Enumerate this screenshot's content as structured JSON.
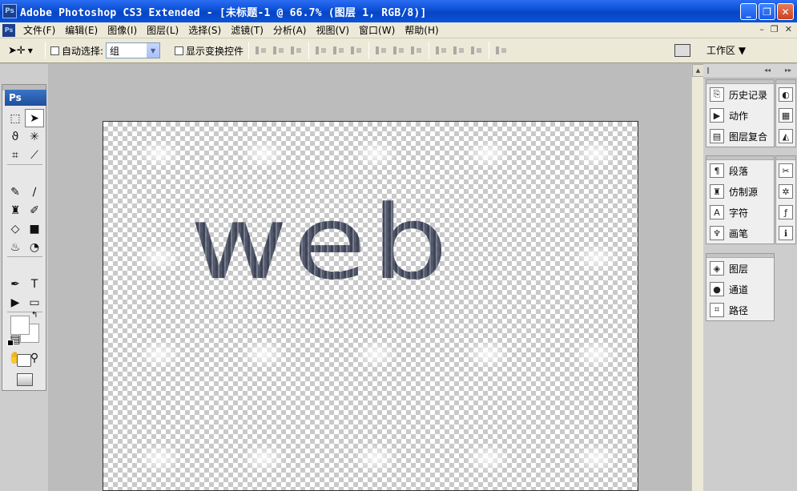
{
  "window": {
    "title": "Adobe Photoshop CS3 Extended - [未标题-1 @ 66.7% (图层 1, RGB/8)]",
    "app_icon": "Ps",
    "buttons": [
      "_",
      "❐",
      "✕"
    ]
  },
  "menu": {
    "items": [
      "文件(F)",
      "编辑(E)",
      "图像(I)",
      "图层(L)",
      "选择(S)",
      "滤镜(T)",
      "分析(A)",
      "视图(V)",
      "窗口(W)",
      "帮助(H)"
    ],
    "doc_buttons": [
      "–",
      "❐",
      "✕"
    ]
  },
  "options": {
    "auto_select_label": "自动选择:",
    "auto_select_value": "组",
    "show_transform_label": "显示变换控件",
    "workspace_label": "工作区 ▼"
  },
  "toolbox": {
    "logo": "Ps"
  },
  "canvas": {
    "text": "web"
  },
  "panels": {
    "group1": [
      "历史记录",
      "动作",
      "图层复合"
    ],
    "group2": [
      "段落",
      "仿制源",
      "字符",
      "画笔"
    ],
    "group3": [
      "图层",
      "通道",
      "路径"
    ]
  }
}
